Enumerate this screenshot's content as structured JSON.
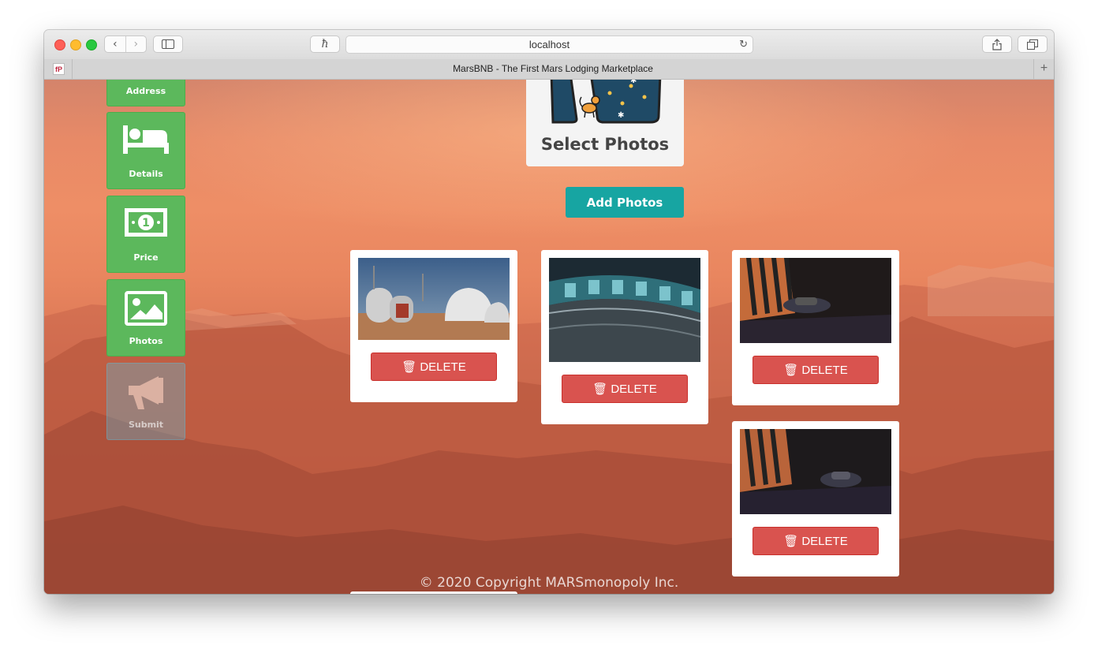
{
  "browser": {
    "url": "localhost",
    "tab_title": "MarsBNB - The First Mars Lodging Marketplace",
    "favicon_text": "fP",
    "icons": [
      "back-icon",
      "forward-icon",
      "sidebar-icon",
      "hive-extension-icon",
      "reload-icon",
      "share-icon",
      "tabs-overview-icon",
      "new-tab-icon"
    ]
  },
  "sidebar": {
    "items": [
      {
        "label": "Address",
        "icon": "map-icon"
      },
      {
        "label": "Details",
        "icon": "bed-icon"
      },
      {
        "label": "Price",
        "icon": "banknote-icon"
      },
      {
        "label": "Photos",
        "icon": "image-icon"
      },
      {
        "label": "Submit",
        "icon": "megaphone-icon"
      }
    ]
  },
  "uploader": {
    "select_label": "Select Photos",
    "add_button": "Add Photos"
  },
  "photos": [
    {
      "delete_label": "DELETE",
      "alt": "Mars habitat domes"
    },
    {
      "delete_label": "DELETE",
      "alt": "Space station corridor"
    },
    {
      "delete_label": "DELETE",
      "alt": "Hangar with vehicle at sunset"
    },
    {
      "delete_label": "DELETE",
      "alt": "Hangar with vehicle at dusk"
    }
  ],
  "footer": {
    "copyright": "© 2020 Copyright MARSmonopoly Inc."
  },
  "colors": {
    "sidebar_green": "#5cb85c",
    "add_button_teal": "#17a5a2",
    "delete_red": "#d9534f"
  }
}
